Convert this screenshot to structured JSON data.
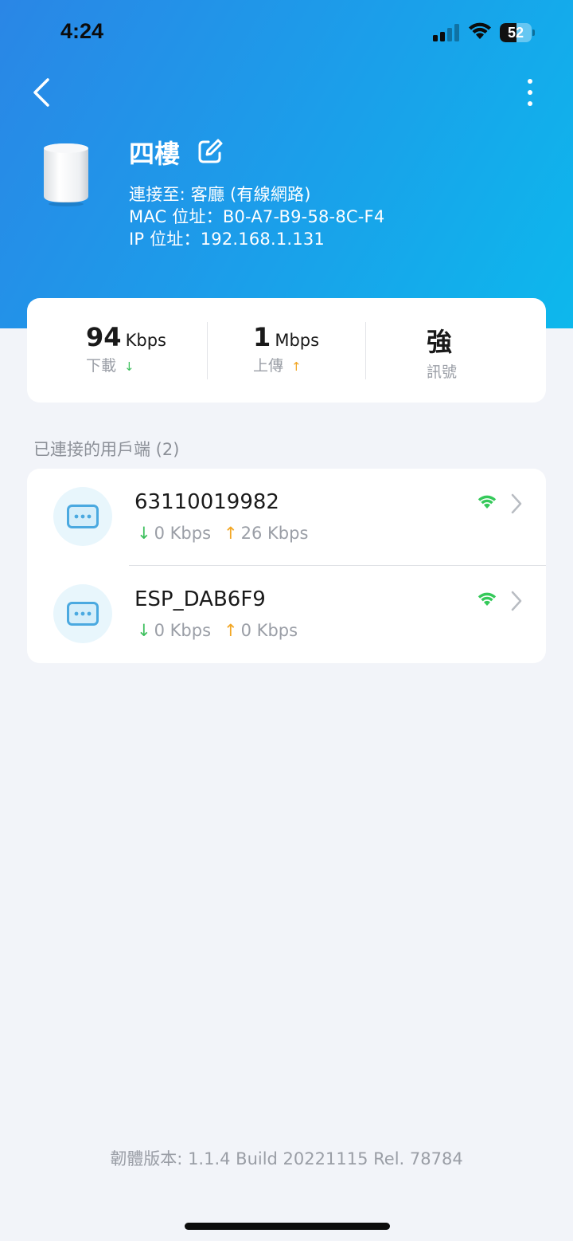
{
  "status_bar": {
    "time": "4:24",
    "battery": "52",
    "battery_level": 0.52
  },
  "device": {
    "name": "四樓",
    "connected_to": "連接至: 客廳 (有線網路)",
    "mac": "MAC 位址：B0-A7-B9-58-8C-F4",
    "ip": "IP 位址：192.168.1.131"
  },
  "stats": {
    "download": {
      "value": "94",
      "unit": "Kbps",
      "label": "下載",
      "arrow": "↓"
    },
    "upload": {
      "value": "1",
      "unit": "Mbps",
      "label": "上傳",
      "arrow": "↑"
    },
    "signal": {
      "value": "強",
      "label": "訊號"
    }
  },
  "clients": {
    "title": "已連接的用戶端 (2)",
    "items": [
      {
        "name": "63110019982",
        "down": "0 Kbps",
        "up": "26 Kbps"
      },
      {
        "name": "ESP_DAB6F9",
        "down": "0 Kbps",
        "up": "0 Kbps"
      }
    ]
  },
  "footer": {
    "firmware": "韌體版本: 1.1.4 Build 20221115 Rel. 78784"
  },
  "icons": {
    "back": "chevron-left-icon",
    "more": "more-vertical-icon",
    "edit": "edit-icon",
    "wifi": "wifi-icon",
    "chevron": "chevron-right-icon",
    "client": "device-dots-icon"
  },
  "colors": {
    "header_start": "#2a86e6",
    "header_end": "#0db8ec",
    "download_green": "#3cbf5c",
    "upload_orange": "#f2a623",
    "client_icon": "#4aa9e0"
  }
}
